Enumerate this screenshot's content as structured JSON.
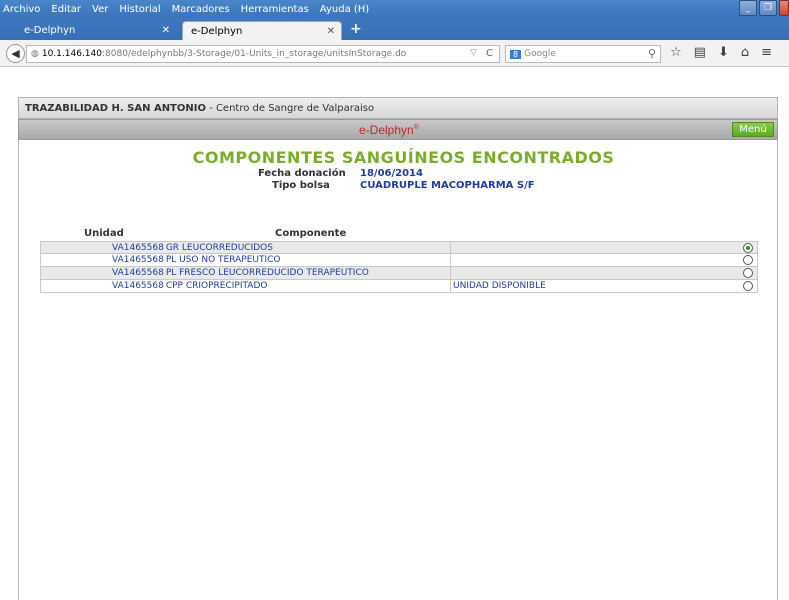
{
  "browser": {
    "menu": [
      "Archivo",
      "Editar",
      "Ver",
      "Historial",
      "Marcadores",
      "Herramientas",
      "Ayuda (H)"
    ],
    "tabs": [
      {
        "label": "e-Delphyn",
        "active": false
      },
      {
        "label": "e-Delphyn",
        "active": true
      }
    ],
    "url_host": "10.1.146.140",
    "url_path": ":8080/edelphynbb/3-Storage/01-Units_in_storage/unitsInStorage.do",
    "search_placeholder": "Google"
  },
  "app": {
    "header_bold": "TRAZABILIDAD H. SAN ANTONIO",
    "header_rest": " - Centro de Sangre de Valparaiso",
    "brand": "e-Delphyn",
    "brand_mark": "®",
    "menu_label": "Menú"
  },
  "page": {
    "title": "COMPONENTES SANGUÍNEOS ENCONTRADOS",
    "fecha_label": "Fecha donación",
    "fecha_value": "18/06/2014",
    "tipo_label": "Tipo bolsa",
    "tipo_value": "CUADRUPLE MACOPHARMA S/F",
    "col_unidad": "Unidad",
    "col_componente": "Componente"
  },
  "rows": [
    {
      "unit": "VA1465568",
      "component": "GR LEUCORREDUCIDOS",
      "status": "",
      "selected": true
    },
    {
      "unit": "VA1465568",
      "component": "PL USO NO TERAPEUTICO",
      "status": "",
      "selected": false
    },
    {
      "unit": "VA1465568",
      "component": "PL FRESCO LEUCORREDUCIDO TERAPEUTICO",
      "status": "",
      "selected": false
    },
    {
      "unit": "VA1465568",
      "component": "CPP CRIOPRECIPITADO",
      "status": "UNIDAD DISPONIBLE",
      "selected": false
    }
  ],
  "colors": {
    "title_green": "#7aae2a",
    "value_blue": "#1f3d9c",
    "brand_red": "#c0262b"
  }
}
